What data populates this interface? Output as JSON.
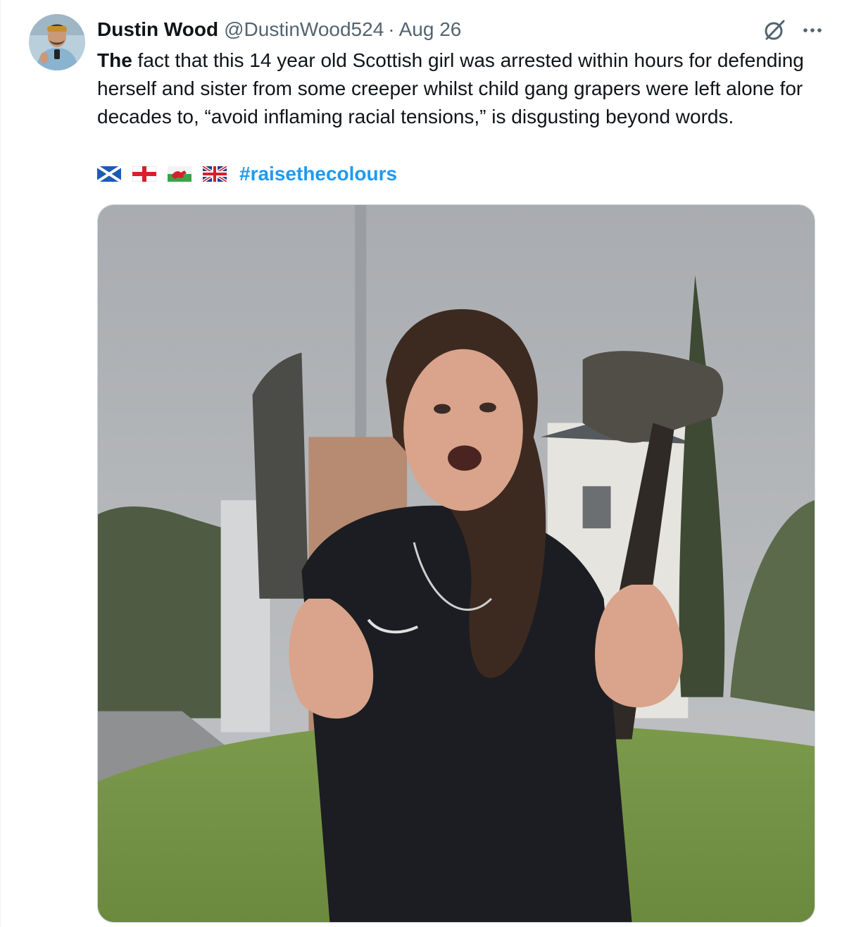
{
  "author": {
    "name": "Dustin Wood",
    "handle": "@DustinWood524",
    "separator": "·",
    "date": "Aug 26"
  },
  "tweet": {
    "lead_word": "The",
    "body": " fact that this 14 year old Scottish girl was arrested within hours for defending herself and sister from some creeper whilst child gang grapers were left alone for decades to, “avoid inflaming racial tensions,” is disgusting beyond words.",
    "flags": [
      "scotland-flag",
      "england-flag",
      "wales-flag",
      "uk-flag"
    ],
    "hashtag": "#raisethecolours"
  },
  "icons": {
    "grok": "grok-icon",
    "more": "more-options-icon"
  },
  "colors": {
    "link": "#1d9bf0",
    "secondary_text": "#536471",
    "primary_text": "#0f1419",
    "border": "#cfd9de"
  }
}
